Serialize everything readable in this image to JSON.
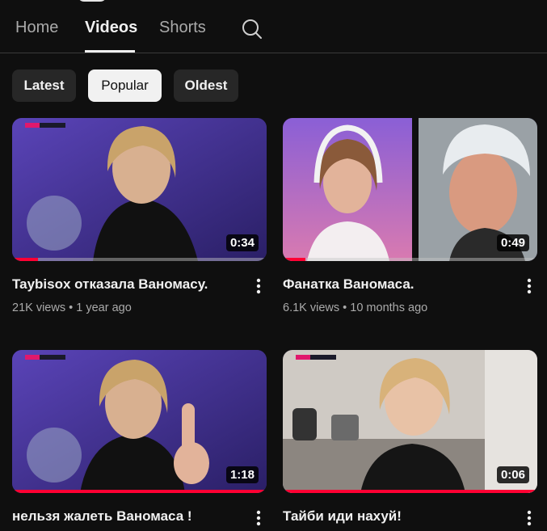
{
  "tabs": [
    {
      "label": "Home",
      "active": false
    },
    {
      "label": "Videos",
      "active": true
    },
    {
      "label": "Shorts",
      "active": false
    }
  ],
  "chips": [
    {
      "label": "Latest",
      "active": false
    },
    {
      "label": "Popular",
      "active": true
    },
    {
      "label": "Oldest",
      "active": false
    }
  ],
  "videos": [
    {
      "title": "Taybisox отказала Ваномасу.",
      "views": "21K views",
      "age": "1 year ago",
      "duration": "0:34",
      "watched": 0.1
    },
    {
      "title": "Фанатка Ваномаса.",
      "views": "6.1K views",
      "age": "10 months ago",
      "duration": "0:49",
      "watched": 0.09
    },
    {
      "title": "нельзя жалеть Ваномаса !",
      "duration": "1:18",
      "watched": 1.0
    },
    {
      "title": "Тайби иди нахуй!",
      "duration": "0:06",
      "watched": 1.0
    }
  ],
  "colors": {
    "background": "#0f0f0f",
    "chip": "#272727",
    "accent": "#ff0033",
    "secondary_text": "#aaaaaa"
  },
  "icons": {
    "search": "search-icon",
    "more": "more-vert-icon"
  }
}
